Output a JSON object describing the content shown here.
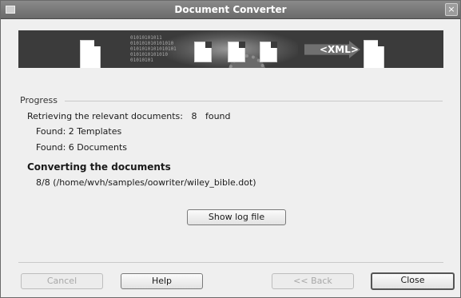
{
  "window": {
    "title": "Document Converter"
  },
  "banner": {
    "xml_label": "<XML>",
    "binary_text": "01010101011\n010101010101010\n0101010101010101\n0101010101010\n01010101"
  },
  "progress": {
    "group_label": "Progress",
    "retrieve_text": "Retrieving the relevant documents:",
    "retrieve_count": "8",
    "retrieve_suffix": "found",
    "found_templates": "Found: 2 Templates",
    "found_documents": "Found: 6 Documents",
    "converting_heading": "Converting the documents",
    "current_file": "8/8  (/home/wvh/samples/oowriter/wiley_bible.dot)"
  },
  "buttons": {
    "show_log": "Show log file",
    "cancel": "Cancel",
    "help": "Help",
    "back": "<< Back",
    "close": "Close"
  },
  "colors": {
    "titlebar": "#7a7a7a",
    "banner_bg": "#3b3b3b",
    "dialog_bg": "#efefef"
  }
}
